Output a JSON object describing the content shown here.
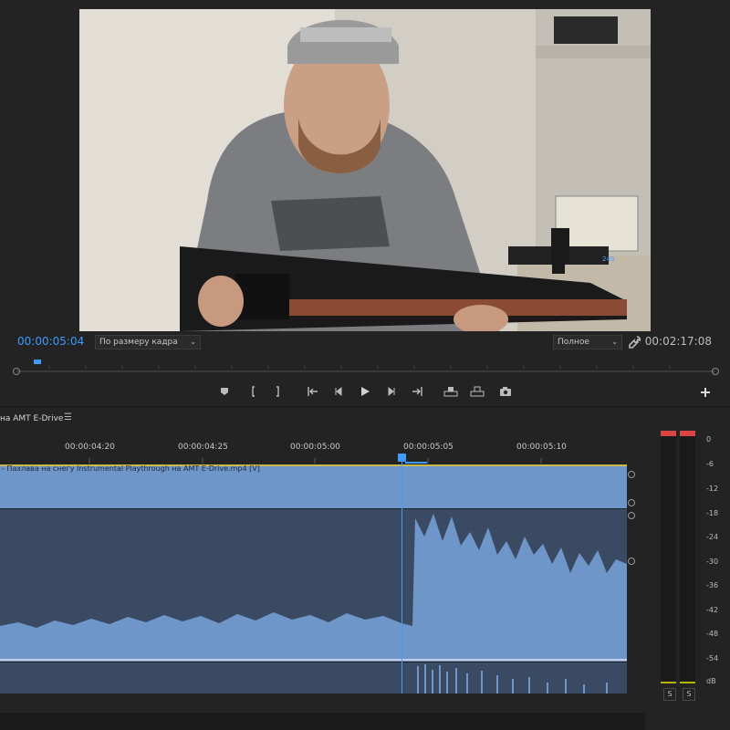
{
  "monitor": {
    "timecode_current": "00:00:05:04",
    "timecode_duration": "00:02:17:08",
    "fit_select": "По размеру кадра",
    "quality_select": "Полное",
    "video_overlay_text": "249",
    "icons": [
      "marker-icon",
      "mark-in-icon",
      "mark-out-icon",
      "go-to-in-icon",
      "step-back-icon",
      "play-icon",
      "step-forward-icon",
      "go-to-out-icon",
      "lift-icon",
      "extract-icon",
      "export-frame-icon",
      "add-button-icon",
      "wrench-icon"
    ]
  },
  "timeline": {
    "sequence_tab": "на AMT E-Drive",
    "ruler_labels": [
      "00:00:04:20",
      "00:00:04:25",
      "00:00:05:00",
      "00:00:05:05",
      "00:00:05:10"
    ],
    "clip_label": "- Пахлава на снегу Instrumental Playthrough на AMT E-Drive.mp4 [V]"
  },
  "meters": {
    "db_scale": [
      "0",
      "-6",
      "-12",
      "-18",
      "-24",
      "-30",
      "-36",
      "-42",
      "-48",
      "-54",
      "dB"
    ],
    "solo_labels": [
      "S",
      "S"
    ]
  },
  "colors": {
    "accent": "#3e9bff",
    "clip_video": "#6f96c9",
    "clip_audio": "#3a4a63",
    "meter_peak": "#d94545"
  }
}
